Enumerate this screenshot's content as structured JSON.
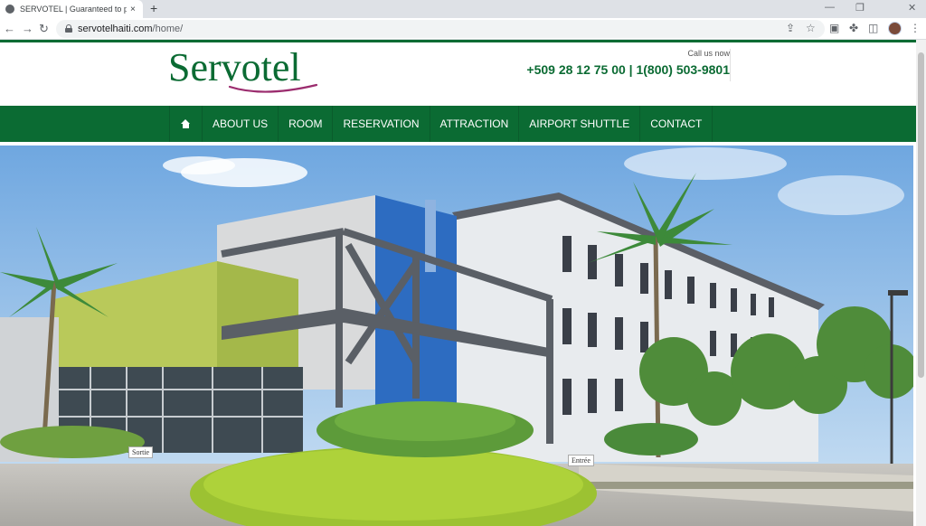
{
  "browser": {
    "tab_title": "SERVOTEL | Guaranteed to provi",
    "tab_close": "×",
    "new_tab": "+",
    "url_host": "servotelhaiti.com",
    "url_path": "/home/",
    "icons": [
      "back-icon",
      "forward-icon",
      "reload-icon",
      "lock-icon",
      "share-icon",
      "star-icon",
      "extension-icon",
      "puzzle-icon",
      "sidepanel-icon",
      "profile-avatar",
      "menu-icon"
    ]
  },
  "header": {
    "logo_text": "Servotel",
    "call_label": "Call us now",
    "phone": "+509 28 12 75 00 | 1(800) 503-9801"
  },
  "nav": {
    "items": [
      {
        "label": "ABOUT US"
      },
      {
        "label": "ROOM"
      },
      {
        "label": "RESERVATION"
      },
      {
        "label": "ATTRACTION"
      },
      {
        "label": "AIRPORT SHUTTLE"
      },
      {
        "label": "CONTACT"
      }
    ]
  },
  "hero": {
    "sign_exit": "Sortie",
    "sign_entry": "Entrée"
  },
  "colors": {
    "brand_green": "#0b6b33",
    "accent_purple": "#9b2c6e"
  }
}
